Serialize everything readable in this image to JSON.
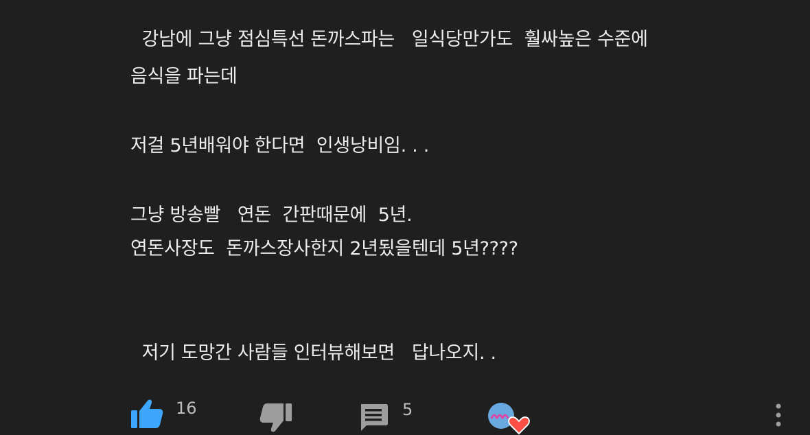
{
  "comment": {
    "lines": [
      "  강남에 그냥 점심특선 돈까스파는   일식당만가도  훨싸높은 수준에",
      "음식을 파는데",
      "저걸 5년배워야 한다면  인생낭비임. . .",
      "그냥 방송빨   연돈  간판때문에  5년.",
      "연돈사장도  돈까스장사한지 2년됬을텐데 5년????",
      "  저기 도망간 사람들 인터뷰해보면   답나오지. ."
    ]
  },
  "actions": {
    "like_count": "16",
    "reply_count": "5",
    "like_icon": "thumbs-up-icon",
    "dislike_icon": "thumbs-down-icon",
    "reply_icon": "comment-icon",
    "more_icon": "more-vertical-icon",
    "creator_heart_icon": "creator-heart-icon"
  },
  "colors": {
    "background": "#1f1f1f",
    "text": "#ececec",
    "like_active": "#3ea6ff",
    "icon_gray": "#9e9e9e",
    "heart": "#ff4e45"
  }
}
